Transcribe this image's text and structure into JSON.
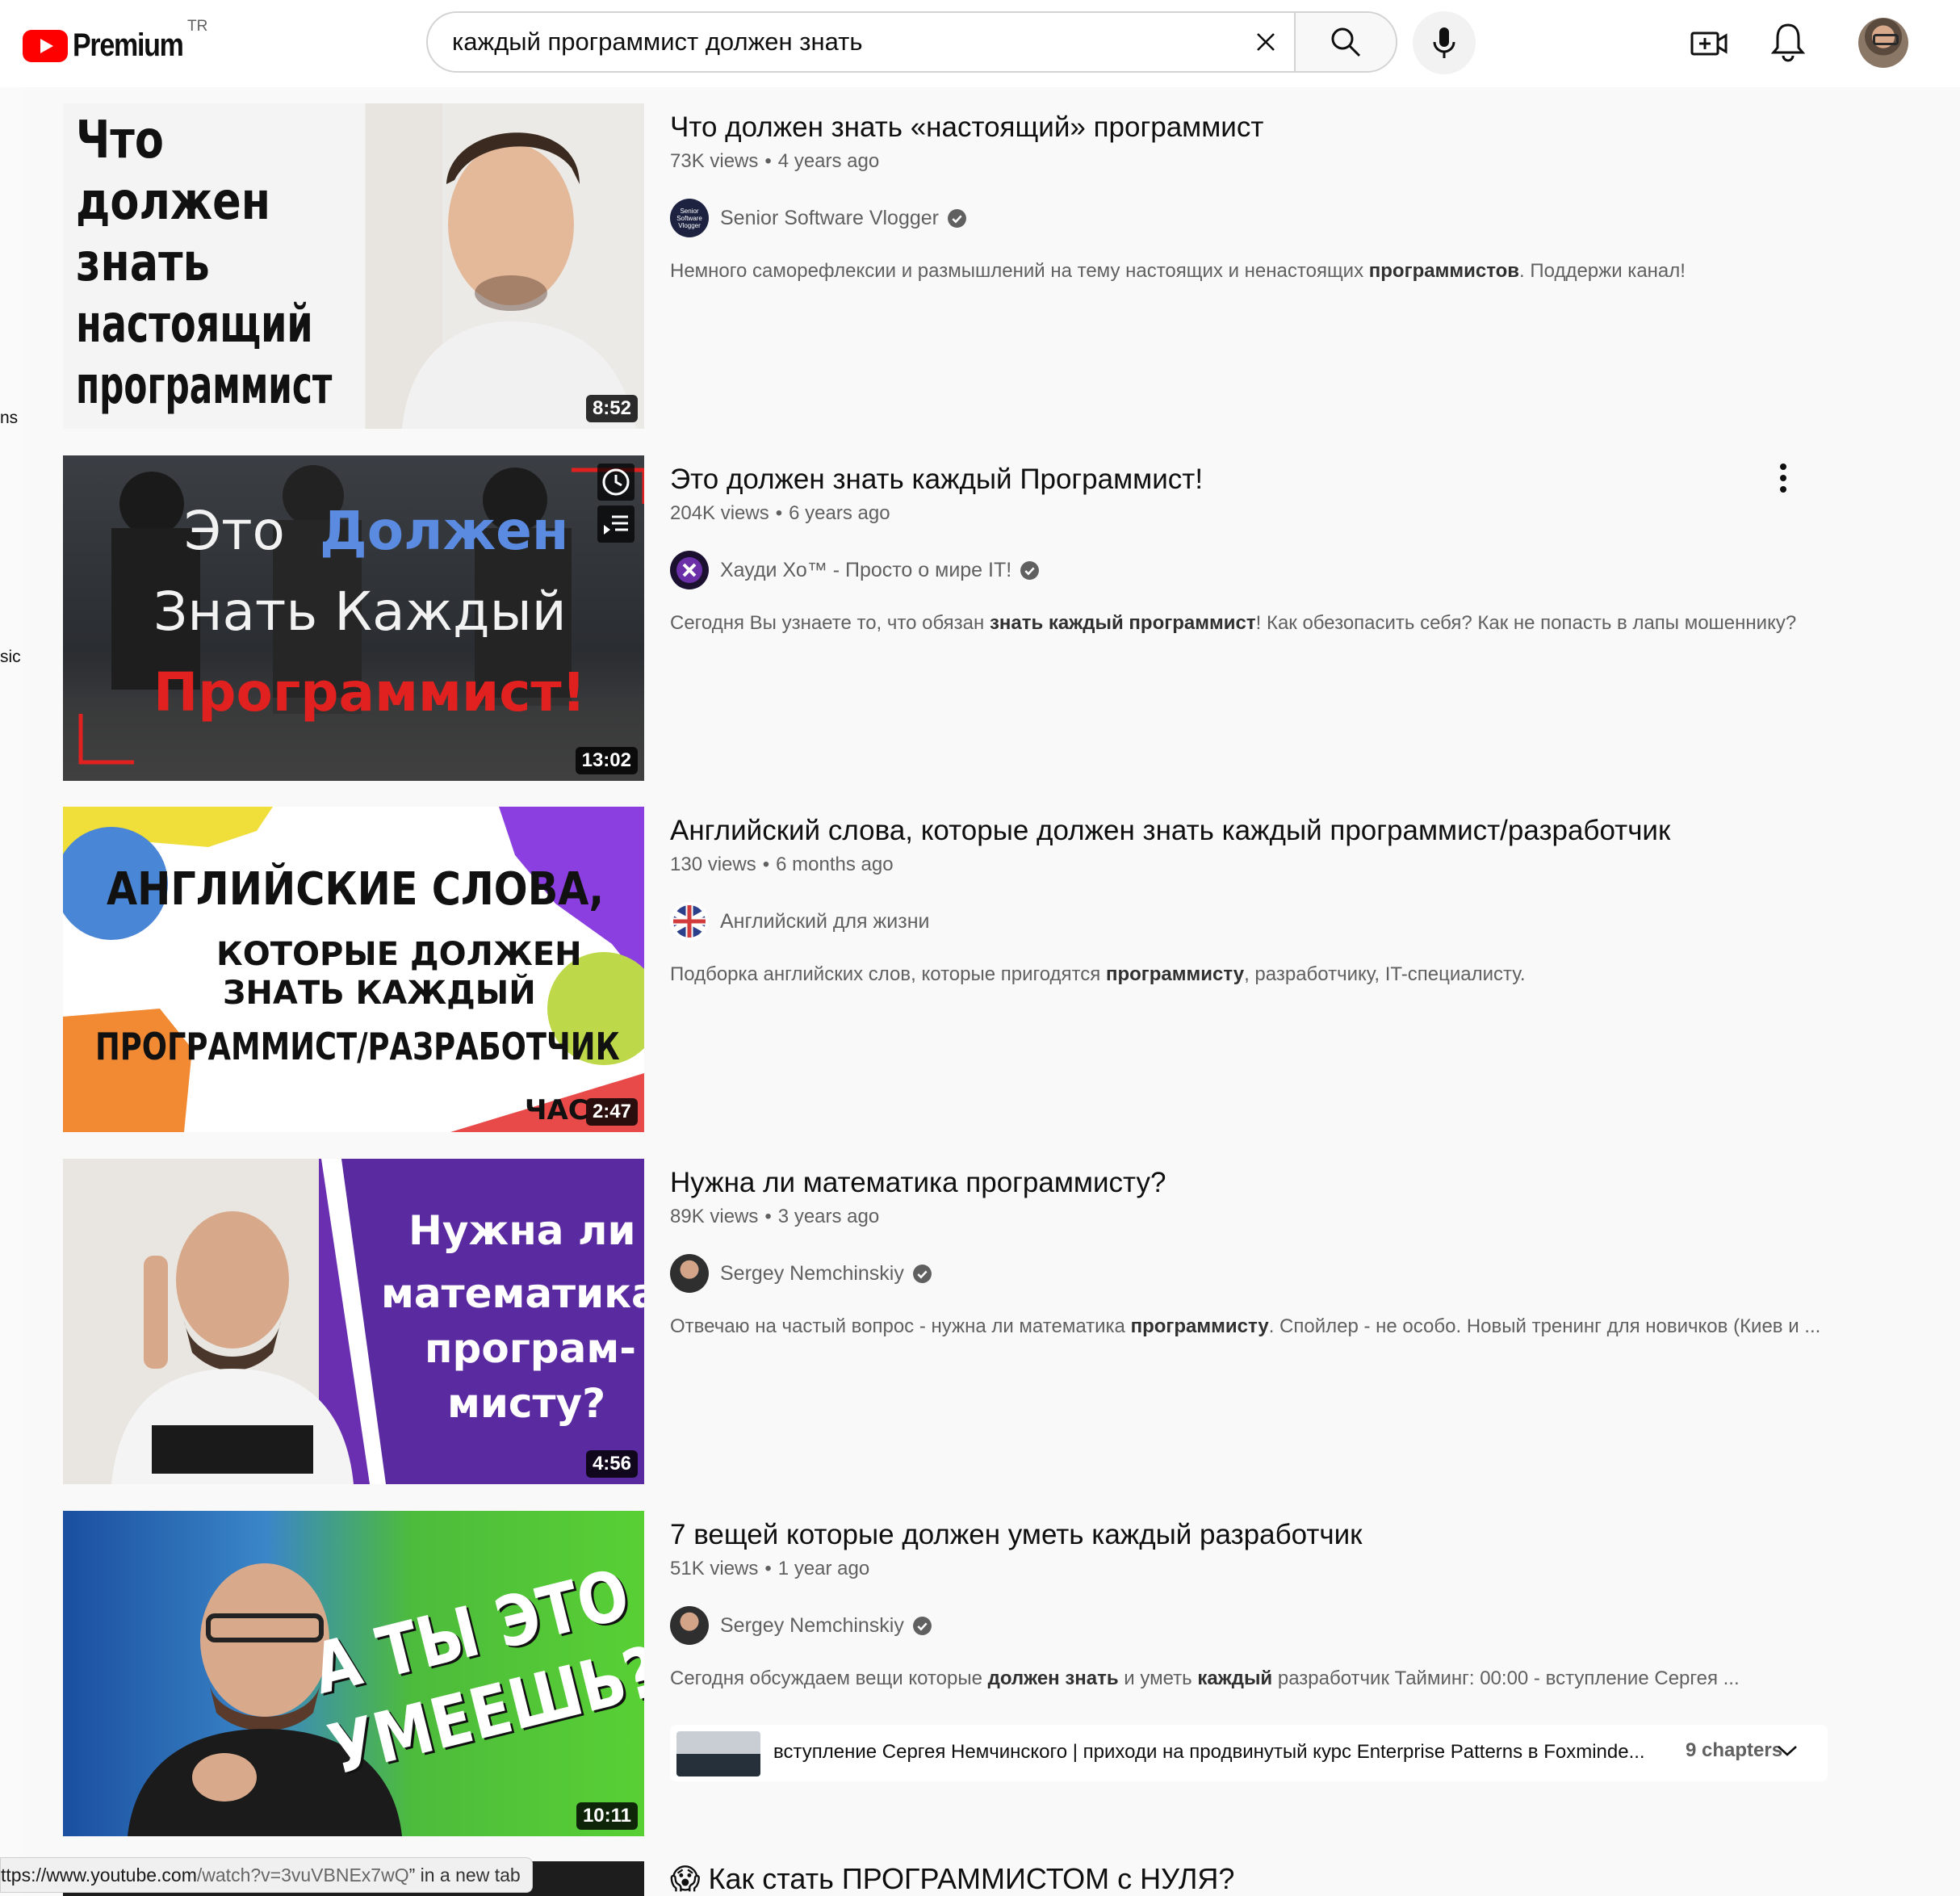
{
  "header": {
    "logo_text": "Premium",
    "country": "TR",
    "search_value": "каждый программист должен знать"
  },
  "sidebar_fragments": [
    "ns",
    "sic"
  ],
  "results": [
    {
      "title": "Что должен знать «настоящий» программист",
      "views": "73K views",
      "age": "4 years ago",
      "channel": "Senior Software Vlogger",
      "channel_avatar_text": "Senior Software Vlogger",
      "verified": true,
      "desc_parts": [
        "Немного саморефлексии и размышлений на тему настоящих и ненастоящих ",
        "программистов",
        ". Поддержи канал!"
      ],
      "duration": "8:52",
      "thumb_text": [
        "Что",
        "должен",
        "знать",
        "настоящий",
        "программист"
      ]
    },
    {
      "title": "Это должен знать каждый Программист!",
      "views": "204K views",
      "age": "6 years ago",
      "channel": "Хауди Хо™ - Просто о мире IT!",
      "verified": true,
      "desc_parts": [
        "Сегодня Вы узнаете то, что обязан ",
        "знать каждый программист",
        "! Как обезопасить себя? Как не попасть в лапы мошеннику?"
      ],
      "duration": "13:02",
      "thumb_text": [
        "Это",
        "Должен",
        "Знать Каждый",
        "Программист!"
      ]
    },
    {
      "title": "Английский слова, которые должен знать каждый программист/разработчик",
      "views": "130 views",
      "age": "6 months ago",
      "channel": "Английский для жизни",
      "verified": false,
      "desc_parts": [
        "Подборка английских слов, которые пригодятся ",
        "программисту",
        ", разработчику, IT-специалисту."
      ],
      "duration": "2:47",
      "thumb_text": [
        "АНГЛИЙСКИЕ СЛОВА,",
        "КОТОРЫЕ ДОЛЖЕН",
        "ЗНАТЬ КАЖДЫЙ",
        "ПРОГРАММИСТ/РАЗРАБОТЧИК",
        "ЧАС"
      ]
    },
    {
      "title": "Нужна ли математика программисту?",
      "views": "89K views",
      "age": "3 years ago",
      "channel": "Sergey Nemchinskiy",
      "verified": true,
      "desc_parts": [
        "Отвечаю на частый вопрос - нужна ли математика ",
        "программисту",
        ". Спойлер - не особо. Новый тренинг для новичков (Киев и ..."
      ],
      "duration": "4:56",
      "thumb_text": [
        "Нужна ли",
        "математика",
        "програм-",
        "мисту?"
      ]
    },
    {
      "title": "7 вещей которые должен уметь каждый разработчик",
      "views": "51K views",
      "age": "1 year ago",
      "channel": "Sergey Nemchinskiy",
      "verified": true,
      "desc_parts": [
        "Сегодня обсуждаем вещи которые ",
        "должен знать",
        " и уметь ",
        "каждый",
        " разработчик Тайминг: 00:00 - вступление Сергея ..."
      ],
      "duration": "10:11",
      "thumb_text": [
        "А ТЫ ЭТО",
        "УМЕЕШЬ?"
      ],
      "chapters": {
        "first_title": "вступление Сергея Немчинского | приходи на продвинутый курс Enterprise Patterns в Foxminde...",
        "count": "9 chapters"
      }
    }
  ],
  "partial_result": {
    "emoji": "😱",
    "title": "Как стать ПРОГРАММИСТОМ с НУЛЯ?"
  },
  "url_tooltip": {
    "prefix": "ttps://www.youtube.com",
    "path": "/watch?v=3vuVBNEx7wQ",
    "suffix": "” in a new tab"
  },
  "colors": {
    "brand_red": "#ff0000",
    "text_primary": "#0f0f0f",
    "text_secondary": "#606060",
    "background": "#f9f9f9"
  }
}
